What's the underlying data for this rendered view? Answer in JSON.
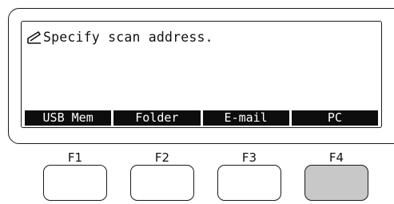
{
  "display": {
    "message_icon": "pen-icon",
    "message": "Specify scan address.",
    "softkeys": [
      {
        "label": "USB Mem"
      },
      {
        "label": "Folder"
      },
      {
        "label": "E-mail"
      },
      {
        "label": "PC"
      }
    ]
  },
  "function_keys": [
    {
      "label": "F1",
      "highlighted": false
    },
    {
      "label": "F2",
      "highlighted": false
    },
    {
      "label": "F3",
      "highlighted": false
    },
    {
      "label": "F4",
      "highlighted": true
    }
  ],
  "colors": {
    "softkey_background": "#0d0d0d",
    "softkey_text": "#ffffff",
    "highlighted_key": "#c8c8c8",
    "outline": "#1a1a1a"
  }
}
